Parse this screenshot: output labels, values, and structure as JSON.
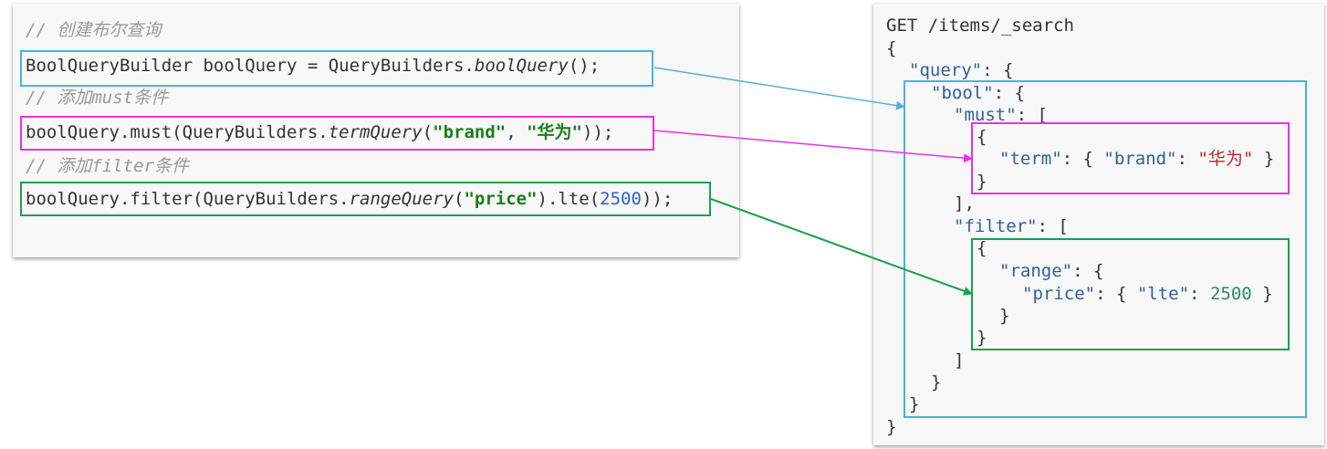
{
  "java": {
    "comment1": "// 创建布尔查询",
    "line1": {
      "a": "BoolQueryBuilder boolQuery = QueryBuilders.",
      "b": "boolQuery",
      "c": "();"
    },
    "comment2": "// 添加must条件",
    "line2": {
      "a": "boolQuery.must(QueryBuilders.",
      "b": "termQuery",
      "c": "(",
      "d": "\"brand\"",
      "e": ", ",
      "f": "\"华为\"",
      "g": "));"
    },
    "comment3": "// 添加filter条件",
    "line3": {
      "a": "boolQuery.filter(QueryBuilders.",
      "b": "rangeQuery",
      "c": "(",
      "d": "\"price\"",
      "e": ").lte(",
      "f": "2500",
      "g": "));"
    }
  },
  "json": {
    "request": "GET /items/_search",
    "open_brace": "{",
    "query_key": "\"query\"",
    "bool_key": "\"bool\"",
    "must_key": "\"must\"",
    "term_key": "\"term\"",
    "brand_key": "\"brand\"",
    "brand_value": "\"华为\"",
    "filter_key": "\"filter\"",
    "range_key": "\"range\"",
    "price_key": "\"price\"",
    "lte_key": "\"lte\"",
    "lte_value": "2500",
    "close_brace": "}"
  },
  "colors": {
    "bool": "#45b4e3",
    "must": "#ec2fe6",
    "filter": "#17a24a"
  }
}
